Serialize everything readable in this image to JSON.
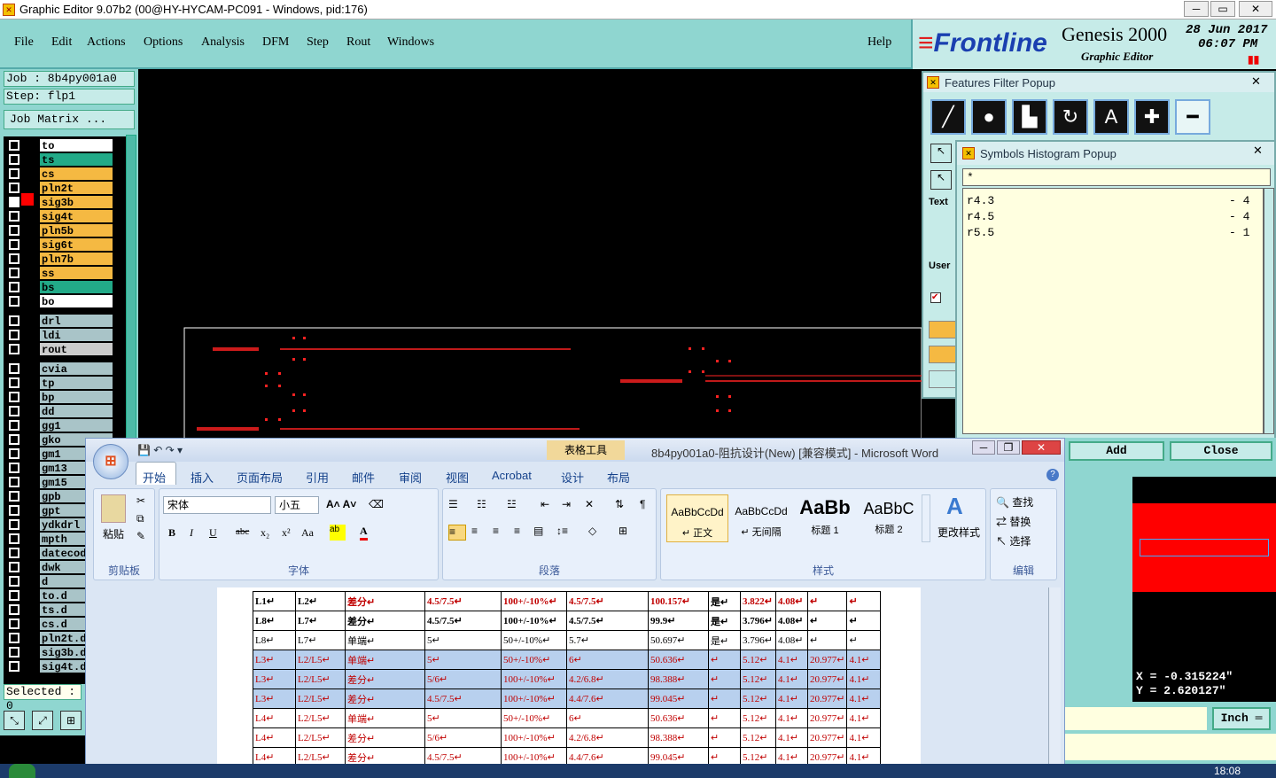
{
  "window": {
    "title": "Graphic Editor 9.07b2 (00@HY-HYCAM-PC091 - Windows, pid:176)"
  },
  "menu": {
    "items": [
      "File",
      "Edit",
      "Actions",
      "Options",
      "Analysis",
      "DFM",
      "Step",
      "Rout",
      "Windows"
    ],
    "help": "Help"
  },
  "brand": {
    "logo": "Frontline",
    "product": "Genesis 2000",
    "subtitle": "Graphic Editor",
    "date": "28 Jun 2017",
    "time": "06:07 PM"
  },
  "job": {
    "job": "Job : 8b4py001a0",
    "step": "Step: flp1",
    "matrix": "Job Matrix ...",
    "selected": "Selected : 0"
  },
  "layers": [
    {
      "name": "to",
      "color": "#ffffff"
    },
    {
      "name": "ts",
      "color": "#22aa88"
    },
    {
      "name": "cs",
      "color": "#f5b942"
    },
    {
      "name": "pln2t",
      "color": "#f5b942"
    },
    {
      "name": "sig3b",
      "color": "#f5b942"
    },
    {
      "name": "sig4t",
      "color": "#f5b942"
    },
    {
      "name": "pln5b",
      "color": "#f5b942"
    },
    {
      "name": "sig6t",
      "color": "#f5b942"
    },
    {
      "name": "pln7b",
      "color": "#f5b942"
    },
    {
      "name": "ss",
      "color": "#f5b942"
    },
    {
      "name": "bs",
      "color": "#22aa88"
    },
    {
      "name": "bo",
      "color": "#ffffff"
    },
    {
      "name": "drl",
      "color": "#a9c4c8"
    },
    {
      "name": "ldi",
      "color": "#a9c4c8"
    },
    {
      "name": "rout",
      "color": "#cccccc"
    },
    {
      "name": "cvia",
      "color": "#a9c4c8"
    },
    {
      "name": "tp",
      "color": "#a9c4c8"
    },
    {
      "name": "bp",
      "color": "#a9c4c8"
    },
    {
      "name": "dd",
      "color": "#a9c4c8"
    },
    {
      "name": "gg1",
      "color": "#a9c4c8"
    },
    {
      "name": "gko",
      "color": "#a9c4c8"
    },
    {
      "name": "gm1",
      "color": "#a9c4c8"
    },
    {
      "name": "gm13",
      "color": "#a9c4c8"
    },
    {
      "name": "gm15",
      "color": "#a9c4c8"
    },
    {
      "name": "gpb",
      "color": "#a9c4c8"
    },
    {
      "name": "gpt",
      "color": "#a9c4c8"
    },
    {
      "name": "ydkdrl",
      "color": "#a9c4c8"
    },
    {
      "name": "mpth",
      "color": "#a9c4c8"
    },
    {
      "name": "datecod",
      "color": "#a9c4c8"
    },
    {
      "name": "dwk",
      "color": "#a9c4c8"
    },
    {
      "name": "d",
      "color": "#a9c4c8"
    },
    {
      "name": "to.d",
      "color": "#a9c4c8"
    },
    {
      "name": "ts.d",
      "color": "#a9c4c8"
    },
    {
      "name": "cs.d",
      "color": "#a9c4c8"
    },
    {
      "name": "pln2t.d",
      "color": "#a9c4c8"
    },
    {
      "name": "sig3b.d",
      "color": "#a9c4c8"
    },
    {
      "name": "sig4t.d",
      "color": "#a9c4c8"
    }
  ],
  "ff_popup": {
    "title": "Features Filter Popup",
    "text_label": "Text",
    "user_label": "User"
  },
  "sh_popup": {
    "title": "Symbols Histogram Popup",
    "filter": "*",
    "rows": [
      {
        "sym": "r4.3",
        "count": "- 4"
      },
      {
        "sym": "r4.5",
        "count": "- 4"
      },
      {
        "sym": "r5.5",
        "count": "- 1"
      }
    ],
    "add": "Add",
    "close": "Close"
  },
  "coords": {
    "x": "X = -0.315224\"",
    "y": "Y = 2.620127\"",
    "unit": "Inch"
  },
  "word": {
    "title": "8b4py001a0-阻抗设计(New) [兼容模式] - Microsoft Word",
    "context_tab": "表格工具",
    "tabs": [
      "开始",
      "插入",
      "页面布局",
      "引用",
      "邮件",
      "审阅",
      "视图",
      "Acrobat",
      "设计",
      "布局"
    ],
    "font": "宋体",
    "size": "小五",
    "paste": "粘贴",
    "groups": [
      "剪贴板",
      "字体",
      "段落",
      "样式",
      "编辑"
    ],
    "styles": [
      {
        "preview": "AaBbCcDd",
        "name": "↵ 正文"
      },
      {
        "preview": "AaBbCcDd",
        "name": "↵ 无间隔"
      },
      {
        "preview": "AaBb",
        "name": "标题 1"
      },
      {
        "preview": "AaBbC",
        "name": "标题 2"
      }
    ],
    "change_styles": "更改样式",
    "find": "查找",
    "replace": "替换",
    "select": "选择"
  },
  "table": [
    [
      "L1↵",
      "L2↵",
      "差分↵",
      "4.5/7.5↵",
      "100+/-10%↵",
      "4.5/7.5↵",
      "100.157↵",
      "是↵",
      "3.822↵",
      "4.08↵",
      "↵",
      "↵"
    ],
    [
      "L8↵",
      "L7↵",
      "差分↵",
      "4.5/7.5↵",
      "100+/-10%↵",
      "4.5/7.5↵",
      "99.9↵",
      "是↵",
      "3.796↵",
      "4.08↵",
      "↵",
      "↵"
    ],
    [
      "L8↵",
      "L7↵",
      "单端↵",
      "5↵",
      "50+/-10%↵",
      "5.7↵",
      "50.697↵",
      "是↵",
      "3.796↵",
      "4.08↵",
      "↵",
      "↵"
    ],
    [
      "L3↵",
      "L2/L5↵",
      "单端↵",
      "5↵",
      "50+/-10%↵",
      "6↵",
      "50.636↵",
      "↵",
      "5.12↵",
      "4.1↵",
      "20.977↵",
      "4.1↵"
    ],
    [
      "L3↵",
      "L2/L5↵",
      "差分↵",
      "5/6↵",
      "100+/-10%↵",
      "4.2/6.8↵",
      "98.388↵",
      "↵",
      "5.12↵",
      "4.1↵",
      "20.977↵",
      "4.1↵"
    ],
    [
      "L3↵",
      "L2/L5↵",
      "差分↵",
      "4.5/7.5↵",
      "100+/-10%↵",
      "4.4/7.6↵",
      "99.045↵",
      "↵",
      "5.12↵",
      "4.1↵",
      "20.977↵",
      "4.1↵"
    ],
    [
      "L4↵",
      "L2/L5↵",
      "单端↵",
      "5↵",
      "50+/-10%↵",
      "6↵",
      "50.636↵",
      "↵",
      "5.12↵",
      "4.1↵",
      "20.977↵",
      "4.1↵"
    ],
    [
      "L4↵",
      "L2/L5↵",
      "差分↵",
      "5/6↵",
      "100+/-10%↵",
      "4.2/6.8↵",
      "98.388↵",
      "↵",
      "5.12↵",
      "4.1↵",
      "20.977↵",
      "4.1↵"
    ],
    [
      "L4↵",
      "L2/L5↵",
      "差分↵",
      "4.5/7.5↵",
      "100+/-10%↵",
      "4.4/7.6↵",
      "99.045↵",
      "↵",
      "5.12↵",
      "4.1↵",
      "20.977↵",
      "4.1↵"
    ]
  ],
  "taskbar": {
    "clock": "18:08"
  }
}
